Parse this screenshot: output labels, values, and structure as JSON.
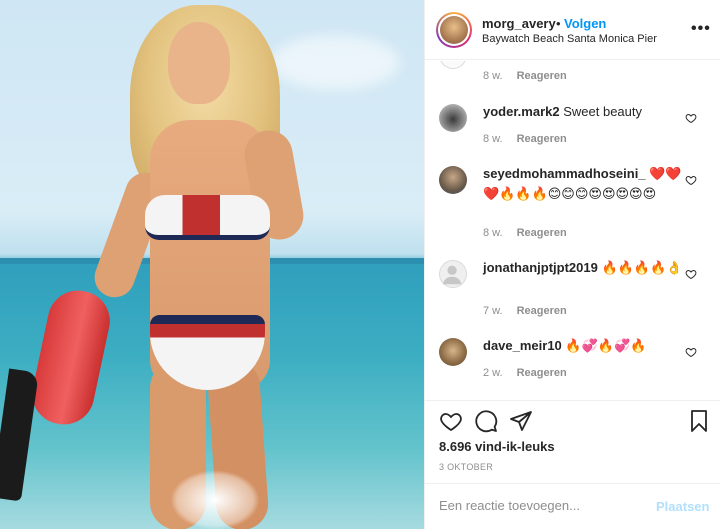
{
  "post": {
    "username": "morg_avery",
    "separator": "•",
    "follow_label": "Volgen",
    "location": "Baywatch Beach Santa Monica Pier",
    "more_icon": "more-horizontal-icon",
    "image_alt": "photo"
  },
  "comments": [
    {
      "username": "",
      "text": "",
      "age": "8 w.",
      "reply": "Reageren"
    },
    {
      "username": "yoder.mark2",
      "text": "Sweet beauty",
      "age": "8 w.",
      "reply": "Reageren"
    },
    {
      "username": "seyedmohammadhoseini_",
      "text": "❤️❤️❤️🔥🔥🔥😊😊😊😍😍😍😍😍",
      "age": "8 w.",
      "reply": "Reageren"
    },
    {
      "username": "jonathanjptjpt2019",
      "text": "🔥🔥🔥🔥👌",
      "age": "7 w.",
      "reply": "Reageren"
    },
    {
      "username": "dave_meir10",
      "text": "🔥💞🔥💞🔥",
      "age": "2 w.",
      "reply": "Reageren"
    }
  ],
  "stats": {
    "likes": "8.696 vind-ik-leuks",
    "date": "3 OKTOBER"
  },
  "composer": {
    "placeholder": "Een reactie toevoegen...",
    "post_label": "Plaatsen"
  },
  "colors": {
    "link": "#0095f6",
    "muted": "#8e8e8e",
    "post_disabled": "#b2dffc"
  }
}
